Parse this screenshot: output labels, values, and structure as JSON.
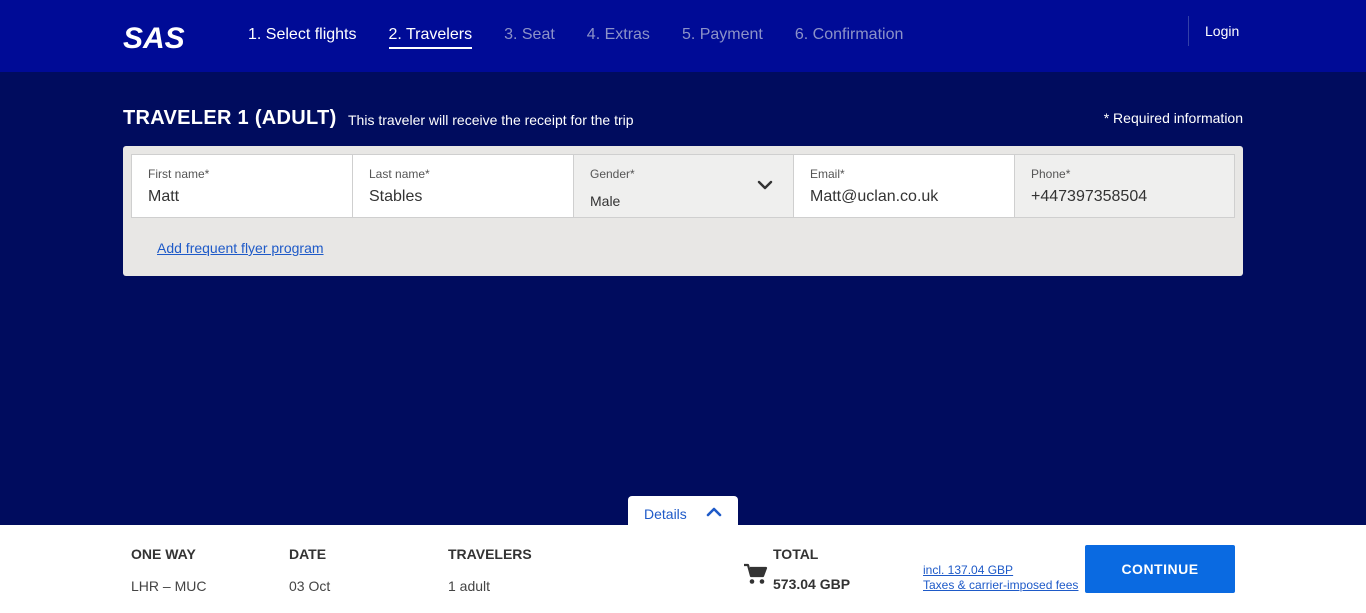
{
  "header": {
    "logo_text": "SAS",
    "steps": [
      {
        "label": "1. Select flights",
        "state": "done"
      },
      {
        "label": "2. Travelers",
        "state": "active"
      },
      {
        "label": "3. Seat",
        "state": "upcoming"
      },
      {
        "label": "4. Extras",
        "state": "upcoming"
      },
      {
        "label": "5. Payment",
        "state": "upcoming"
      },
      {
        "label": "6. Confirmation",
        "state": "upcoming"
      }
    ],
    "login_label": "Login"
  },
  "traveler": {
    "title": "TRAVELER 1 (ADULT)",
    "subtitle": "This traveler will receive the receipt for the trip",
    "required_note": "* Required information",
    "fields": {
      "first_name": {
        "label": "First name*",
        "value": "Matt"
      },
      "last_name": {
        "label": "Last name*",
        "value": "Stables"
      },
      "gender": {
        "label": "Gender*",
        "value": "Male"
      },
      "email": {
        "label": "Email*",
        "value": "Matt@uclan.co.uk"
      },
      "phone": {
        "label": "Phone*",
        "value": "+447397358504"
      }
    },
    "ffp_link": "Add frequent flyer program"
  },
  "details_tab": {
    "label": "Details"
  },
  "summary": {
    "trip_type_label": "ONE WAY",
    "route": "LHR – MUC",
    "date_label": "DATE",
    "date": "03 Oct",
    "travelers_label": "TRAVELERS",
    "travelers": "1 adult",
    "total_label": "TOTAL",
    "total": "573.04 GBP",
    "fees_line1": "incl. 137.04 GBP",
    "fees_line2": "Taxes & carrier-imposed fees",
    "continue_label": "CONTINUE"
  },
  "colors": {
    "header_bg": "#000b96",
    "page_bg": "#000c5e",
    "primary_button": "#0a6ae1",
    "link": "#1e5ac8"
  },
  "icons": [
    "sas-logo",
    "chevron-down-icon",
    "chevron-up-icon",
    "shopping-cart-icon"
  ]
}
